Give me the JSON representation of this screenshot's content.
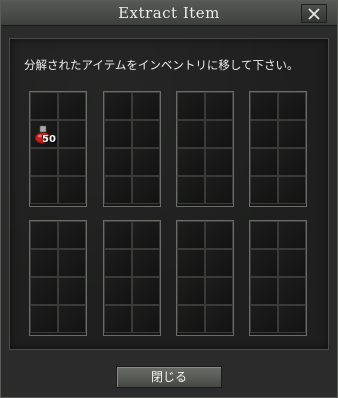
{
  "window": {
    "title": "Extract Item"
  },
  "instruction": "分解されたアイテムをインベントリに移して下さい。",
  "bags": [
    {
      "slots": [
        {
          "item": null
        },
        {
          "item": null
        },
        {
          "item": "potion-icon",
          "count": "50"
        },
        {
          "item": null
        },
        {
          "item": null
        },
        {
          "item": null
        },
        {
          "item": null
        },
        {
          "item": null
        }
      ]
    },
    {
      "slots": [
        {
          "item": null
        },
        {
          "item": null
        },
        {
          "item": null
        },
        {
          "item": null
        },
        {
          "item": null
        },
        {
          "item": null
        },
        {
          "item": null
        },
        {
          "item": null
        }
      ]
    },
    {
      "slots": [
        {
          "item": null
        },
        {
          "item": null
        },
        {
          "item": null
        },
        {
          "item": null
        },
        {
          "item": null
        },
        {
          "item": null
        },
        {
          "item": null
        },
        {
          "item": null
        }
      ]
    },
    {
      "slots": [
        {
          "item": null
        },
        {
          "item": null
        },
        {
          "item": null
        },
        {
          "item": null
        },
        {
          "item": null
        },
        {
          "item": null
        },
        {
          "item": null
        },
        {
          "item": null
        }
      ]
    },
    {
      "slots": [
        {
          "item": null
        },
        {
          "item": null
        },
        {
          "item": null
        },
        {
          "item": null
        },
        {
          "item": null
        },
        {
          "item": null
        },
        {
          "item": null
        },
        {
          "item": null
        }
      ]
    },
    {
      "slots": [
        {
          "item": null
        },
        {
          "item": null
        },
        {
          "item": null
        },
        {
          "item": null
        },
        {
          "item": null
        },
        {
          "item": null
        },
        {
          "item": null
        },
        {
          "item": null
        }
      ]
    },
    {
      "slots": [
        {
          "item": null
        },
        {
          "item": null
        },
        {
          "item": null
        },
        {
          "item": null
        },
        {
          "item": null
        },
        {
          "item": null
        },
        {
          "item": null
        },
        {
          "item": null
        }
      ]
    },
    {
      "slots": [
        {
          "item": null
        },
        {
          "item": null
        },
        {
          "item": null
        },
        {
          "item": null
        },
        {
          "item": null
        },
        {
          "item": null
        },
        {
          "item": null
        },
        {
          "item": null
        }
      ]
    }
  ],
  "footer": {
    "close_label": "閉じる"
  },
  "colors": {
    "potion_liquid": "#c81e1e",
    "potion_glass": "#a8aca8"
  }
}
